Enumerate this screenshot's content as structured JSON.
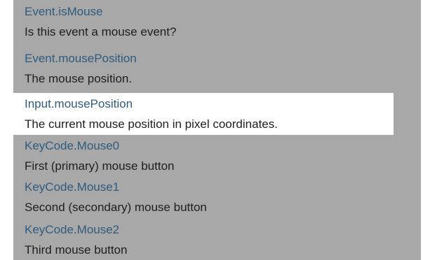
{
  "results": [
    {
      "name": "Event.isMouse",
      "description": "Is this event a mouse event?"
    },
    {
      "name": "Event.mousePosition",
      "description": "The mouse position."
    },
    {
      "name": "Input.mousePosition",
      "description": "The current mouse position in pixel coordinates.",
      "highlighted": true
    },
    {
      "name": "KeyCode.Mouse0",
      "description": "First (primary) mouse button"
    },
    {
      "name": "KeyCode.Mouse1",
      "description": "Second (secondary) mouse button"
    },
    {
      "name": "KeyCode.Mouse2",
      "description": "Third mouse button"
    }
  ],
  "colors": {
    "panel_background": "#a8a8a8",
    "highlight_background": "#ffffff",
    "link": "#2f5b7e",
    "description_text": "#1e1e1e"
  }
}
